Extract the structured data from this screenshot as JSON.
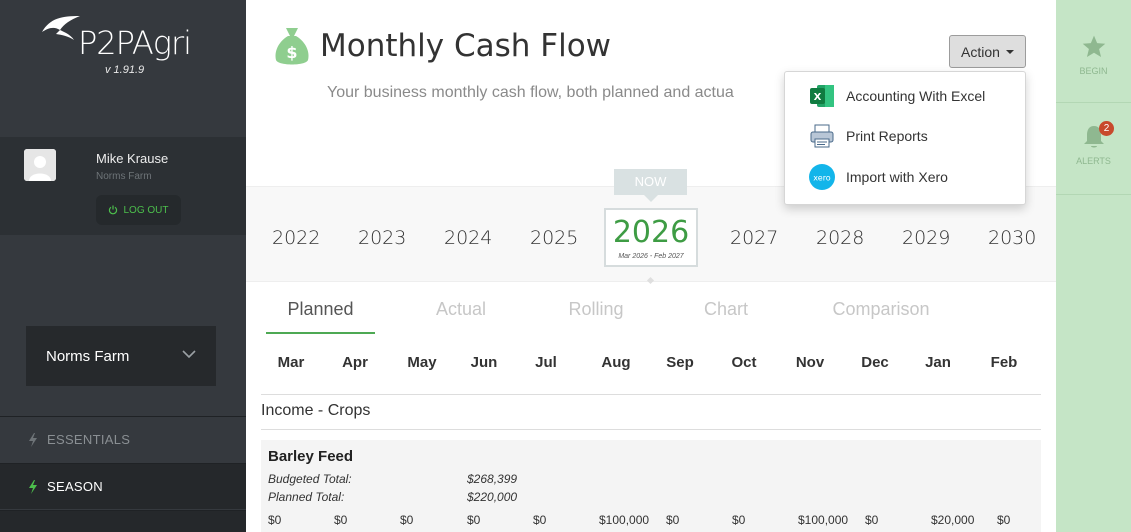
{
  "app": {
    "logo_text": "P2PAgri",
    "version": "v 1.91.9"
  },
  "user": {
    "name": "Mike Krause",
    "farm": "Norms Farm",
    "logout_label": "LOG OUT"
  },
  "farm_selector": {
    "selected": "Norms Farm"
  },
  "nav": {
    "items": [
      {
        "label": "ESSENTIALS"
      },
      {
        "label": "SEASON"
      }
    ]
  },
  "rail": {
    "begin_label": "BEGIN",
    "alerts_label": "ALERTS",
    "alerts_count": "2"
  },
  "page": {
    "title": "Monthly Cash Flow",
    "subtitle": "Your business monthly cash flow, both planned and actua",
    "action_label": "Action"
  },
  "dropdown": {
    "items": [
      {
        "label": "Accounting With Excel",
        "icon": "excel-icon"
      },
      {
        "label": "Print Reports",
        "icon": "printer-icon"
      },
      {
        "label": "Import with Xero",
        "icon": "xero-icon"
      }
    ]
  },
  "years": {
    "now_label": "NOW",
    "list": [
      "2022",
      "2023",
      "2024",
      "2025",
      "2027",
      "2028",
      "2029",
      "2030"
    ],
    "current": "2026",
    "current_range": "Mar 2026 - Feb 2027"
  },
  "tabs": [
    "Planned",
    "Actual",
    "Rolling",
    "Chart",
    "Comparison"
  ],
  "months": [
    "Mar",
    "Apr",
    "May",
    "Jun",
    "Jul",
    "Aug",
    "Sep",
    "Oct",
    "Nov",
    "Dec",
    "Jan",
    "Feb"
  ],
  "section": {
    "title": "Income - Crops"
  },
  "crop": {
    "name": "Barley Feed",
    "budgeted_label": "Budgeted Total:",
    "budgeted_value": "$268,399",
    "planned_label": "Planned Total:",
    "planned_value": "$220,000",
    "monthly": [
      "$0",
      "$0",
      "$0",
      "$0",
      "$0",
      "$100,000",
      "$0",
      "$0",
      "$100,000",
      "$0",
      "$20,000",
      "$0"
    ]
  }
}
